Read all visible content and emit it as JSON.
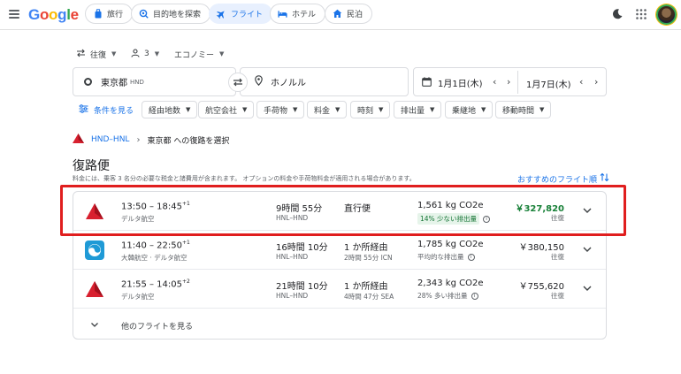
{
  "header": {
    "nav": [
      {
        "label": "旅行",
        "icon": "suitcase-icon"
      },
      {
        "label": "目的地を探索",
        "icon": "explore-icon"
      },
      {
        "label": "フライト",
        "icon": "airplane-icon",
        "active": true
      },
      {
        "label": "ホテル",
        "icon": "bed-icon"
      },
      {
        "label": "民泊",
        "icon": "house-icon"
      }
    ]
  },
  "search": {
    "trip_type": "往復",
    "passengers": "3",
    "cabin": "エコノミー",
    "origin": "東京都",
    "origin_code": "HND",
    "destination": "ホノルル",
    "depart_date": "1月1日(木)",
    "return_date": "1月7日(木)"
  },
  "filters": {
    "all_filters": "条件を見る",
    "chips": [
      "経由地数",
      "航空会社",
      "手荷物",
      "料金",
      "時刻",
      "排出量",
      "乗継地",
      "移動時間"
    ]
  },
  "breadcrumb": {
    "route": "HND–HNL",
    "step": "東京都 への復路を選択"
  },
  "results": {
    "title": "復路便",
    "notice": "料金には、乗客 3 名分の必要な税金と諸費用が含まれます。 オプションの料金や手荷物料金が適用される場合があります。",
    "sort_label": "おすすめのフライト順",
    "flights": [
      {
        "time": "13:50 – 18:45",
        "day_offset": "+1",
        "airline": "デルタ航空",
        "duration": "9時間 55分",
        "route": "HNL–HND",
        "stops": "直行便",
        "stop_detail": "",
        "co2": "1,561 kg CO2e",
        "emissions": "14% 少ない排出量",
        "price": "￥327,820",
        "trip": "往復",
        "logo": "delta"
      },
      {
        "time": "11:40 – 22:50",
        "day_offset": "+1",
        "airline": "大韓航空 · デルタ航空",
        "duration": "16時間 10分",
        "route": "HNL–HND",
        "stops": "1 か所経由",
        "stop_detail": "2時間 55分 ICN",
        "co2": "1,785 kg CO2e",
        "emissions": "平均的な排出量",
        "price": "￥380,150",
        "trip": "往復",
        "logo": "korean"
      },
      {
        "time": "21:55 – 14:05",
        "day_offset": "+2",
        "airline": "デルタ航空",
        "duration": "21時間 10分",
        "route": "HNL–HND",
        "stops": "1 か所経由",
        "stop_detail": "4時間 47分 SEA",
        "co2": "2,343 kg CO2e",
        "emissions": "28% 多い排出量",
        "price": "￥755,620",
        "trip": "往復",
        "logo": "delta"
      }
    ],
    "more_label": "他のフライトを見る"
  },
  "colors": {
    "accent": "#1a73e8",
    "highlight": "#e01e1e",
    "delta_red": "#d8202f",
    "price_green": "#188038"
  }
}
